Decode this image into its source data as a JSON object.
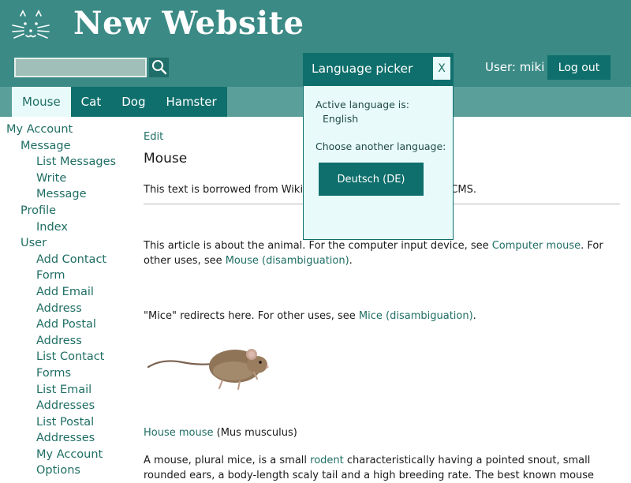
{
  "site": {
    "title": "New Website",
    "logo_icon": "cat-face-icon"
  },
  "header": {
    "search": {
      "value": "",
      "placeholder": ""
    },
    "search_icon": "magnifier-icon",
    "user_label": "User: miki",
    "logout_label": "Log out"
  },
  "tabs": [
    {
      "label": "Mouse",
      "active": true
    },
    {
      "label": "Cat",
      "active": false
    },
    {
      "label": "Dog",
      "active": false
    },
    {
      "label": "Hamster",
      "active": false
    }
  ],
  "sidebar": {
    "title": "My Account",
    "groups": [
      {
        "label": "Message",
        "items": [
          "List Messages",
          "Write Message"
        ]
      },
      {
        "label": "Profile",
        "items": [
          "Index"
        ]
      },
      {
        "label": "User",
        "items": [
          "Add Contact Form",
          "Add Email Address",
          "Add Postal Address",
          "List Contact Forms",
          "List Email Addresses",
          "List Postal Addresses",
          "My Account Options"
        ]
      }
    ],
    "wrapped_lines": {
      "write_1": "Write",
      "write_2": "Message",
      "acf_1": "Add Contact",
      "acf_2": "Form",
      "aea_1": "Add Email",
      "aea_2": "Address",
      "apa_1": "Add Postal",
      "apa_2": "Address",
      "lcf_1": "List Contact",
      "lcf_2": "Forms",
      "lea_1": "List Email",
      "lea_2": "Addresses",
      "lpa_1": "List Postal",
      "lpa_2": "Addresses",
      "mao_1": "My Account",
      "mao_2": "Options"
    }
  },
  "main": {
    "edit_label": "Edit",
    "heading": "Mouse",
    "intro_before": "This text is borrowed from Wikip",
    "intro_after": "CMS.",
    "para1_a": "This article is about the animal. For the computer input device, see ",
    "para1_link1": "Computer mouse",
    "para1_b": ". For other uses, see ",
    "para1_link2": "Mouse (disambiguation)",
    "para1_c": ".",
    "para2_a": "\"Mice\" redirects here. For other uses, see ",
    "para2_link": "Mice (disambiguation)",
    "para2_b": ".",
    "caption_link": "House mouse",
    "caption_rest": " (Mus musculus)",
    "para3_a": "A mouse, plural mice, is a small ",
    "para3_link": "rodent",
    "para3_b": " characteristically having a pointed snout, small rounded ears, a body-length scaly tail and a high breeding rate. The best known mouse"
  },
  "language_picker": {
    "title": "Language picker",
    "close_label": "X",
    "active_label": "Active language is:",
    "active_value": "English",
    "choose_label": "Choose another language:",
    "option_label": "Deutsch (DE)"
  },
  "colors": {
    "header_bg": "#3b8a86",
    "tabbar_bg": "#5a9f9a",
    "accent": "#0f6f6c",
    "popup_bg": "#e8fbfa",
    "link": "#1f6e64"
  }
}
